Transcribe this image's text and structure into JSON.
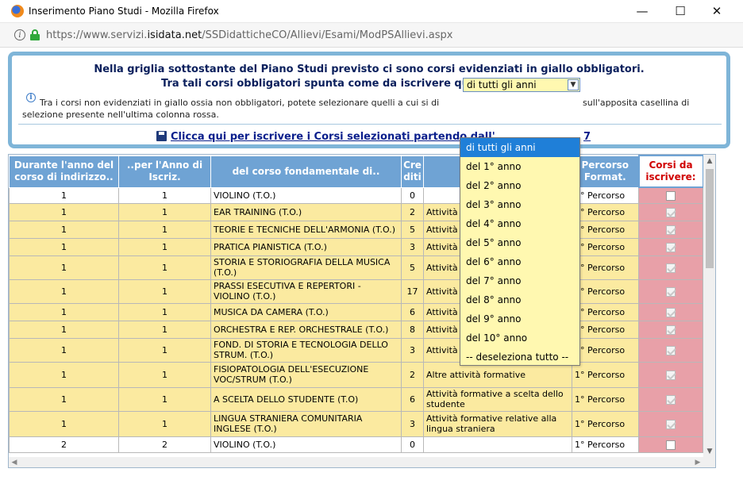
{
  "window": {
    "title": "Inserimento Piano Studi - Mozilla Firefox",
    "minimize": "—",
    "maximize": "☐",
    "close": "✕"
  },
  "urlbar": {
    "prefix": "https://www.servizi.",
    "domain": "isidata.net",
    "path": "/SSDidatticheCO/Allievi/Esami/ModPSAllievi.aspx"
  },
  "panel": {
    "line1": "Nella griglia sottostante del Piano Studi previsto ci sono corsi evidenziati in giallo obbligatori.",
    "line2": "Tra tali corsi obbligatori spunta come da iscrivere quelli:",
    "select_value": "di tutti gli anni",
    "note_part1": "Tra i corsi non evidenziati in giallo ossia non obbligatori, potete selezionare quelli a cui si di",
    "note_part2": "sull'apposita casellina di",
    "note_part3": "selezione presente nell'ultima colonna rossa.",
    "link_part1": "Clicca qui per iscrivere i Corsi selezionati partendo dall'",
    "link_part2": "7"
  },
  "grid": {
    "headers": [
      "Durante l'anno del corso di indirizzo..",
      "..per l'Anno di Iscriz.",
      "del corso fondamentale di..",
      "Cre diti",
      "",
      "Percorso Format.",
      "Corsi da iscrivere:"
    ],
    "rows": [
      {
        "a": "1",
        "b": "1",
        "corso": "VIOLINO (T.O.)",
        "cr": "0",
        "att": "",
        "perc": "1° Percorso",
        "style": "white",
        "check": "empty"
      },
      {
        "a": "1",
        "b": "1",
        "corso": "EAR TRAINING (T.O.)",
        "cr": "2",
        "att": "Attività",
        "perc": "1° Percorso",
        "style": "yellow",
        "check": "checked"
      },
      {
        "a": "1",
        "b": "1",
        "corso": "TEORIE E TECNICHE DELL'ARMONIA (T.O.)",
        "cr": "5",
        "att": "Attività",
        "perc": "1° Percorso",
        "style": "yellow",
        "check": "checked"
      },
      {
        "a": "1",
        "b": "1",
        "corso": "PRATICA PIANISTICA (T.O.)",
        "cr": "3",
        "att": "Attività",
        "perc": "1° Percorso",
        "style": "yellow",
        "check": "checked"
      },
      {
        "a": "1",
        "b": "1",
        "corso": "STORIA E STORIOGRAFIA DELLA MUSICA (T.O.)",
        "cr": "5",
        "att": "Attività",
        "perc": "1° Percorso",
        "style": "yellow",
        "check": "checked"
      },
      {
        "a": "1",
        "b": "1",
        "corso": "PRASSI ESECUTIVA E REPERTORI - VIOLINO (T.O.)",
        "cr": "17",
        "att": "Attività",
        "perc": "1° Percorso",
        "style": "yellow",
        "check": "checked"
      },
      {
        "a": "1",
        "b": "1",
        "corso": "MUSICA DA CAMERA (T.O.)",
        "cr": "6",
        "att": "Attività",
        "perc": "1° Percorso",
        "style": "yellow",
        "check": "checked"
      },
      {
        "a": "1",
        "b": "1",
        "corso": "ORCHESTRA E REP. ORCHESTRALE (T.O.)",
        "cr": "8",
        "att": "Attività formative caratterizzanti",
        "perc": "1° Percorso",
        "style": "yellow",
        "check": "checked"
      },
      {
        "a": "1",
        "b": "1",
        "corso": "FOND. DI STORIA E TECNOLOGIA DELLO STRUM. (T.O.)",
        "cr": "3",
        "att": "Attività formative caratterizzanti",
        "perc": "1° Percorso",
        "style": "yellow",
        "check": "checked"
      },
      {
        "a": "1",
        "b": "1",
        "corso": "FISIOPATOLOGIA DELL'ESECUZIONE VOC/STRUM (T.O.)",
        "cr": "2",
        "att": "Altre attività formative",
        "perc": "1° Percorso",
        "style": "yellow",
        "check": "checked"
      },
      {
        "a": "1",
        "b": "1",
        "corso": "A SCELTA DELLO STUDENTE (T.O)",
        "cr": "6",
        "att": "Attività formative a scelta dello studente",
        "perc": "1° Percorso",
        "style": "yellow",
        "check": "checked"
      },
      {
        "a": "1",
        "b": "1",
        "corso": "LINGUA STRANIERA COMUNITARIA INGLESE (T.O.)",
        "cr": "3",
        "att": "Attività formative relative alla lingua straniera",
        "perc": "1° Percorso",
        "style": "yellow",
        "check": "checked"
      },
      {
        "a": "2",
        "b": "2",
        "corso": "VIOLINO (T.O.)",
        "cr": "0",
        "att": "",
        "perc": "1° Percorso",
        "style": "white",
        "check": "empty"
      }
    ]
  },
  "dropdown": {
    "options": [
      "di tutti gli anni",
      "del 1° anno",
      "del 2° anno",
      "del 3° anno",
      "del 4° anno",
      "del 5° anno",
      "del 6° anno",
      "del 7° anno",
      "del 8° anno",
      "del 9° anno",
      "del 10° anno",
      "-- deseleziona tutto --"
    ],
    "selected_index": 0
  },
  "colors": {
    "header_blue": "#6fa3d4",
    "mandatory_yellow": "#fbeaa0",
    "select_column_red": "#e8a0a8",
    "highlight_blue": "#1f7fd8"
  }
}
